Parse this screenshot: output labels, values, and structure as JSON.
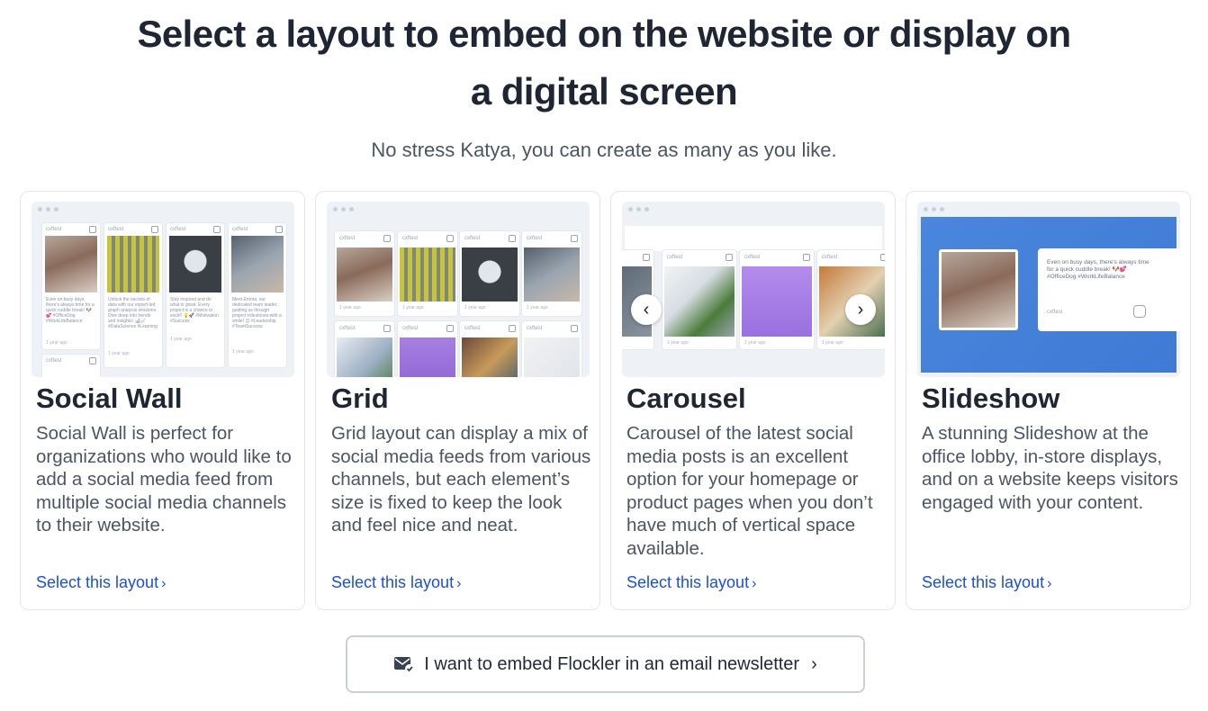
{
  "header": {
    "title_line1": "Select a layout to embed on the website or display on",
    "title_line2": "a digital screen",
    "subtitle": "No stress Katya, you can create as many as you like."
  },
  "layouts": [
    {
      "name": "Social Wall",
      "description": "Social Wall is perfect for organizations who would like to add a social media feed from multiple social media channels to their website.",
      "link": "Select this layout"
    },
    {
      "name": "Grid",
      "description": "Grid layout can display a mix of social media feeds from various channels, but each element’s size is fixed to keep the look and feel nice and neat.",
      "link": "Select this layout"
    },
    {
      "name": "Carousel",
      "description": "Carousel of the latest social media posts is an excellent option for your homepage or product pages when you don’t have much of vertical space available.",
      "link": "Select this layout"
    },
    {
      "name": "Slideshow",
      "description": "A stunning Slideshow at the office lobby, in-store displays, and on a website keeps visitors engaged with your content.",
      "link": "Select this layout"
    }
  ],
  "preview": {
    "account": "cxftest",
    "post_age": "1 year ago",
    "slideshow_post": "Even on busy days, there's always time for a quick cuddle break! 🐶💕 #OfficeDog #WorkLifeBalance",
    "wall_posts": [
      "Even on busy days, there's always time for a quick cuddle break! 🐶💕 #OfficeDog #WorkLifeBalance",
      "Unlock the secrets of data with our expert-led graph analysis sessions. Dive deep into trends and insights! 📊📈 #DataScience #Learning",
      "Stay inspired and do what is great. Every project is a chance to excel! 💡🚀 #Motivation #Success",
      "Meet Emma, our dedicated team leader, guiding us through project milestones with a smile! 😊 #Leadership #TeamSuccess"
    ]
  },
  "footer": {
    "embed_button": "I want to embed Flockler in an email newsletter"
  },
  "colors": {
    "link": "#1d4ed8",
    "heading": "#1e2533",
    "slideshow_bg": "#4a86dc"
  }
}
